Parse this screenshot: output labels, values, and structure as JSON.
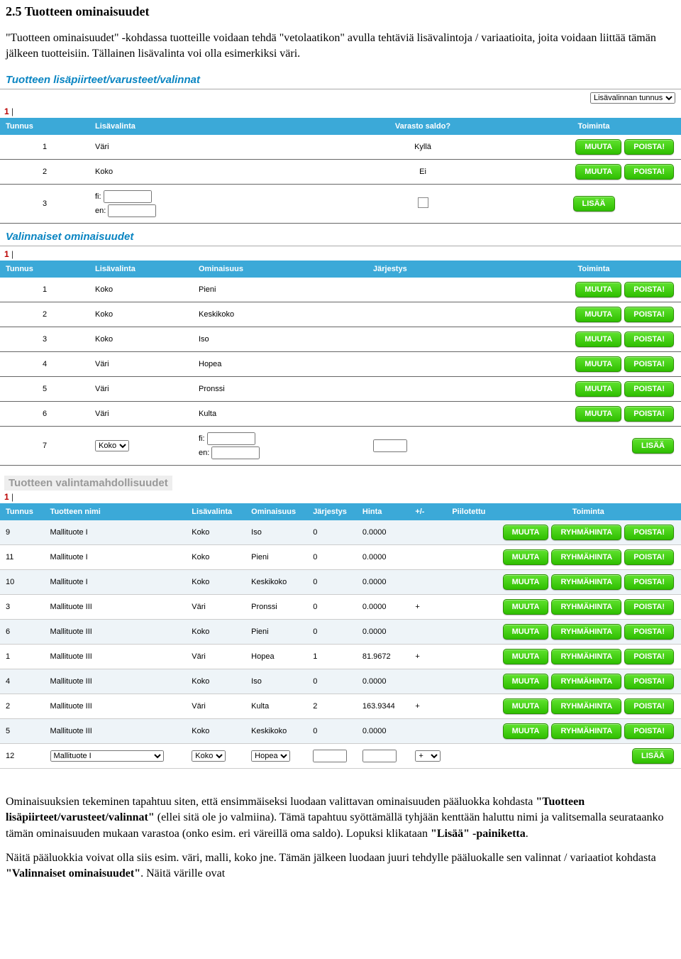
{
  "heading": "2.5 Tuotteen ominaisuudet",
  "intro_para": "\"Tuotteen ominaisuudet\" -kohdassa tuotteille voidaan tehdä \"vetolaatikon\" avulla tehtäviä lisävalintoja / variaatioita, joita voidaan liittää tämän jälkeen tuotteisiin. Tällainen lisävalinta voi olla esimerkiksi väri.",
  "para2": "Ominaisuuksien tekeminen tapahtuu siten, että ensimmäiseksi luodaan valittavan ominaisuuden pääluokka kohdasta \"Tuotteen lisäpiirteet/varusteet/valinnat\" (ellei sitä ole jo valmiina). Tämä tapahtuu syöttämällä tyhjään kenttään haluttu nimi ja valitsemalla seurataanko tämän ominaisuuden mukaan varastoa (onko esim. eri väreillä oma saldo). Lopuksi klikataan \"Lisää\" -painiketta.",
  "para3": "Näitä pääluokkia voivat olla siis esim. väri, malli, koko jne. Tämän jälkeen luodaan juuri tehdylle pääluokalle sen valinnat / variaatiot kohdasta \"Valinnaiset ominaisuudet\". Näitä värille ovat",
  "section1": {
    "title": "Tuotteen lisäpiirteet/varusteet/valinnat",
    "sort_select": "Lisävalinnan tunnus",
    "page_label": "1",
    "headers": [
      "Tunnus",
      "Lisävalinta",
      "Varasto saldo?",
      "Toiminta"
    ],
    "rows": [
      {
        "id": "1",
        "name": "Väri",
        "stock": "Kyllä"
      },
      {
        "id": "2",
        "name": "Koko",
        "stock": "Ei"
      }
    ],
    "new_id": "3",
    "lang_fi": "fi:",
    "lang_en": "en:"
  },
  "section2": {
    "title": "Valinnaiset ominaisuudet",
    "page_label": "1",
    "headers": [
      "Tunnus",
      "Lisävalinta",
      "Ominaisuus",
      "Järjestys",
      "Toiminta"
    ],
    "rows": [
      {
        "id": "1",
        "lv": "Koko",
        "om": "Pieni"
      },
      {
        "id": "2",
        "lv": "Koko",
        "om": "Keskikoko"
      },
      {
        "id": "3",
        "lv": "Koko",
        "om": "Iso"
      },
      {
        "id": "4",
        "lv": "Väri",
        "om": "Hopea"
      },
      {
        "id": "5",
        "lv": "Väri",
        "om": "Pronssi"
      },
      {
        "id": "6",
        "lv": "Väri",
        "om": "Kulta"
      }
    ],
    "new_id": "7",
    "new_select": "Koko",
    "lang_fi": "fi:",
    "lang_en": "en:"
  },
  "section3": {
    "title": "Tuotteen valintamahdollisuudet",
    "page_label": "1",
    "headers": [
      "Tunnus",
      "Tuotteen nimi",
      "Lisävalinta",
      "Ominaisuus",
      "Järjestys",
      "Hinta",
      "+/-",
      "Piilotettu",
      "Toiminta"
    ],
    "rows": [
      {
        "id": "9",
        "prod": "Mallituote I",
        "lv": "Koko",
        "om": "Iso",
        "j": "0",
        "h": "0.0000",
        "pm": ""
      },
      {
        "id": "11",
        "prod": "Mallituote I",
        "lv": "Koko",
        "om": "Pieni",
        "j": "0",
        "h": "0.0000",
        "pm": ""
      },
      {
        "id": "10",
        "prod": "Mallituote I",
        "lv": "Koko",
        "om": "Keskikoko",
        "j": "0",
        "h": "0.0000",
        "pm": ""
      },
      {
        "id": "3",
        "prod": "Mallituote III",
        "lv": "Väri",
        "om": "Pronssi",
        "j": "0",
        "h": "0.0000",
        "pm": "+"
      },
      {
        "id": "6",
        "prod": "Mallituote III",
        "lv": "Koko",
        "om": "Pieni",
        "j": "0",
        "h": "0.0000",
        "pm": ""
      },
      {
        "id": "1",
        "prod": "Mallituote III",
        "lv": "Väri",
        "om": "Hopea",
        "j": "1",
        "h": "81.9672",
        "pm": "+"
      },
      {
        "id": "4",
        "prod": "Mallituote III",
        "lv": "Koko",
        "om": "Iso",
        "j": "0",
        "h": "0.0000",
        "pm": ""
      },
      {
        "id": "2",
        "prod": "Mallituote III",
        "lv": "Väri",
        "om": "Kulta",
        "j": "2",
        "h": "163.9344",
        "pm": "+"
      },
      {
        "id": "5",
        "prod": "Mallituote III",
        "lv": "Koko",
        "om": "Keskikoko",
        "j": "0",
        "h": "0.0000",
        "pm": ""
      }
    ],
    "new_id": "12",
    "new_prod": "Mallituote I",
    "new_lv": "Koko",
    "new_om": "Hopea",
    "new_pm": "+"
  },
  "buttons": {
    "muuta": "MUUTA",
    "poista": "POISTA!",
    "lisaa": "LISÄÄ",
    "ryhma": "RYHMÄHINTA"
  }
}
